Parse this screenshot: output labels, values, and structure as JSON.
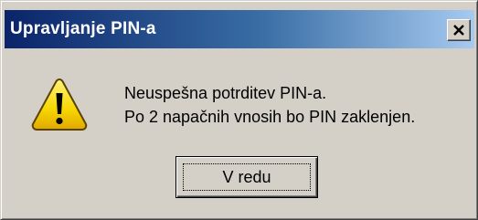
{
  "window": {
    "title": "Upravljanje PIN-a",
    "close_icon": "close-icon"
  },
  "dialog": {
    "icon": "warning-icon",
    "message_line1": "Neuspešna potrditev PIN-a.",
    "message_line2": "Po 2 napačnih vnosih bo PIN zaklenjen.",
    "ok_label": "V redu"
  },
  "colors": {
    "title_gradient_start": "#0a246a",
    "title_gradient_end": "#a6caf0",
    "dialog_background": "#d4d0c8",
    "warning_yellow": "#f7d600"
  }
}
